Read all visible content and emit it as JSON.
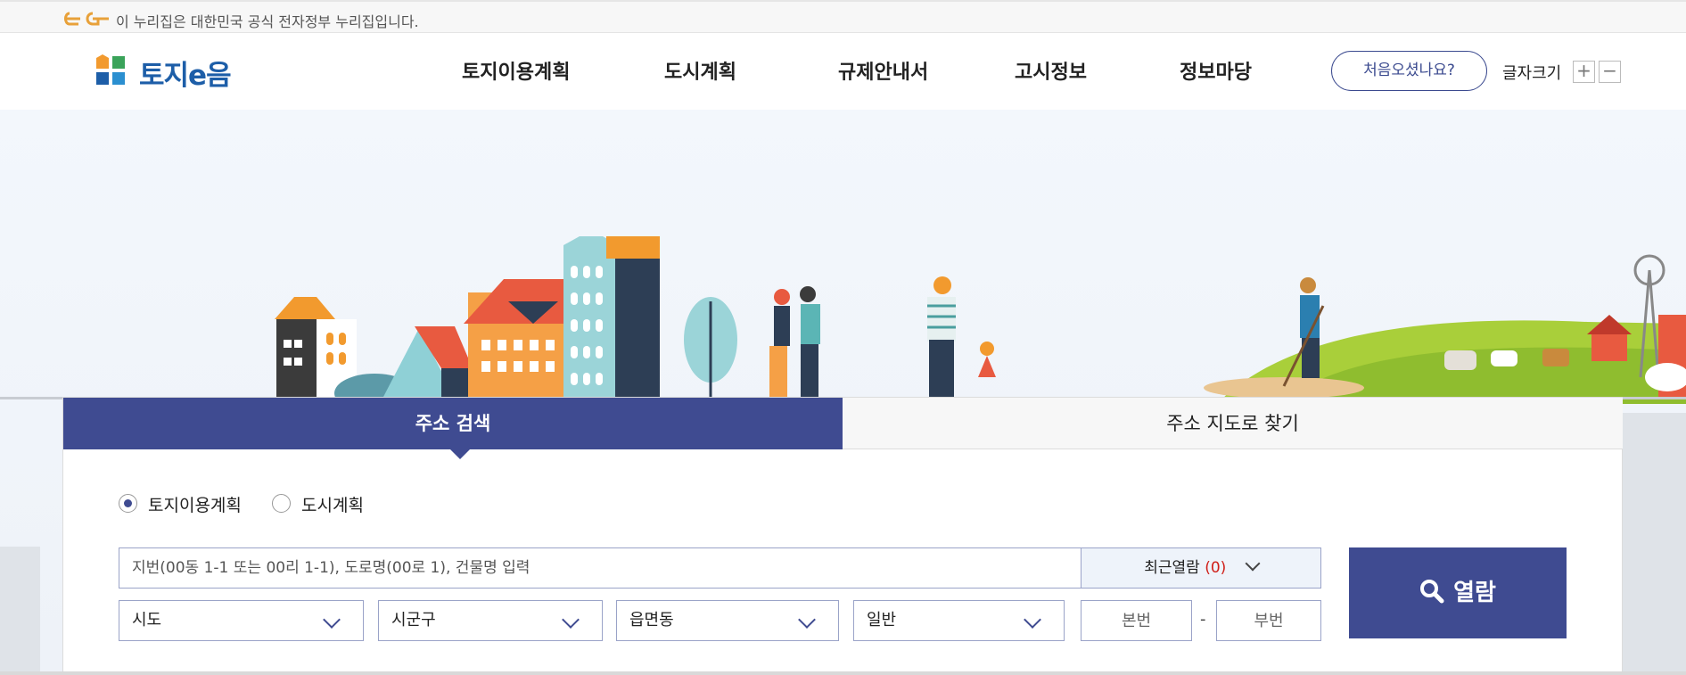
{
  "gov_banner": {
    "text": "이 누리집은 대한민국 공식 전자정부 누리집입니다."
  },
  "brand": {
    "name": "토지e음"
  },
  "nav": [
    {
      "label": "토지이용계획"
    },
    {
      "label": "도시계획"
    },
    {
      "label": "규제안내서"
    },
    {
      "label": "고시정보"
    },
    {
      "label": "정보마당"
    }
  ],
  "utility": {
    "first_visit_label": "처음오셨나요?",
    "font_size_label": "글자크기",
    "font_plus": "+",
    "font_minus": "−"
  },
  "search": {
    "tabs": [
      {
        "label": "주소 검색",
        "active": true
      },
      {
        "label": "주소 지도로 찾기",
        "active": false
      }
    ],
    "radios": [
      {
        "label": "토지이용계획",
        "checked": true
      },
      {
        "label": "도시계획",
        "checked": false
      }
    ],
    "address_placeholder": "지번(00동 1-1 또는 00리 1-1), 도로명(00로 1), 건물명 입력",
    "recent_label": "최근열람",
    "recent_count": "(0)",
    "submit_label": "열람",
    "selects": [
      {
        "value": "시도"
      },
      {
        "value": "시군구"
      },
      {
        "value": "읍면동"
      },
      {
        "value": "일반"
      }
    ],
    "main_number_placeholder": "본번",
    "dash": "-",
    "sub_number_placeholder": "부번"
  },
  "colors": {
    "primary": "#3f4b91",
    "brand_blue": "#1d5ea8",
    "accent_red": "#d0201a",
    "gov_orange": "#e8a13a"
  }
}
